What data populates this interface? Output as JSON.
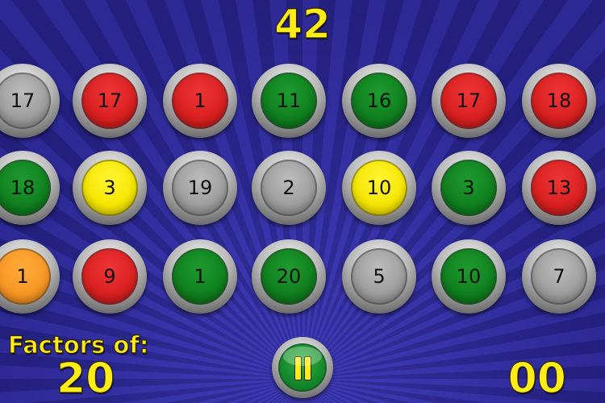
{
  "game": {
    "score": "42",
    "factors_label": "Factors of:",
    "target": "20",
    "timer": "00"
  },
  "colors": {
    "gray": "#a0a0a0",
    "red": "#d91f1f",
    "green": "#0f7f1e",
    "yellow": "#f6e600",
    "orange": "#f79624",
    "text_yellow": "#ffec1a",
    "background": "#2e2aa0"
  },
  "board": {
    "rows": [
      [
        {
          "n": "17",
          "color": "gray"
        },
        {
          "n": "17",
          "color": "red"
        },
        {
          "n": "1",
          "color": "red"
        },
        {
          "n": "11",
          "color": "green"
        },
        {
          "n": "16",
          "color": "green"
        },
        {
          "n": "17",
          "color": "red"
        },
        {
          "n": "18",
          "color": "red"
        }
      ],
      [
        {
          "n": "18",
          "color": "green"
        },
        {
          "n": "3",
          "color": "yellow"
        },
        {
          "n": "19",
          "color": "gray"
        },
        {
          "n": "2",
          "color": "gray"
        },
        {
          "n": "10",
          "color": "yellow"
        },
        {
          "n": "3",
          "color": "green"
        },
        {
          "n": "13",
          "color": "red"
        }
      ],
      [
        {
          "n": "1",
          "color": "orange"
        },
        {
          "n": "9",
          "color": "red"
        },
        {
          "n": "1",
          "color": "green"
        },
        {
          "n": "20",
          "color": "green"
        },
        {
          "n": "5",
          "color": "gray"
        },
        {
          "n": "10",
          "color": "green"
        },
        {
          "n": "7",
          "color": "gray"
        }
      ]
    ]
  },
  "pause_button": {
    "icon": "pause-icon"
  }
}
